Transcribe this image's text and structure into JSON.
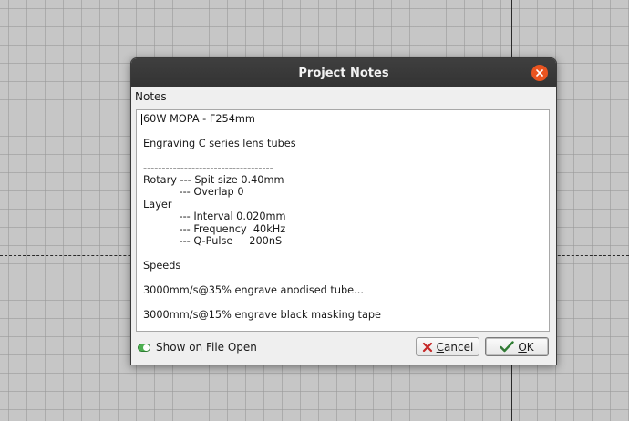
{
  "dialog": {
    "title": "Project Notes",
    "notes_label": "Notes",
    "notes_text": "60W MOPA - F254mm\n\nEngraving C series lens tubes\n\n-----------------------------------\nRotary --- Spit size 0.40mm\n           --- Overlap 0\nLayer\n           --- Interval 0.020mm\n           --- Frequency  40kHz\n           --- Q-Pulse     200nS\n\nSpeeds\n\n3000mm/s@35% engrave anodised tube...\n\n3000mm/s@15% engrave black masking tape",
    "show_on_open_label": "Show on File Open",
    "show_on_open_checked": true,
    "cancel_mnemonic": "C",
    "cancel_rest": "ancel",
    "ok_mnemonic": "O",
    "ok_rest": "K"
  },
  "icons": {
    "close": "close-icon",
    "cancel": "cancel-x-icon",
    "ok": "checkmark-icon"
  },
  "colors": {
    "titlebar": "#363636",
    "close_button": "#e95420",
    "toggle_on": "#4caf50",
    "cancel_icon": "#c62828",
    "ok_icon": "#2e7d32"
  }
}
